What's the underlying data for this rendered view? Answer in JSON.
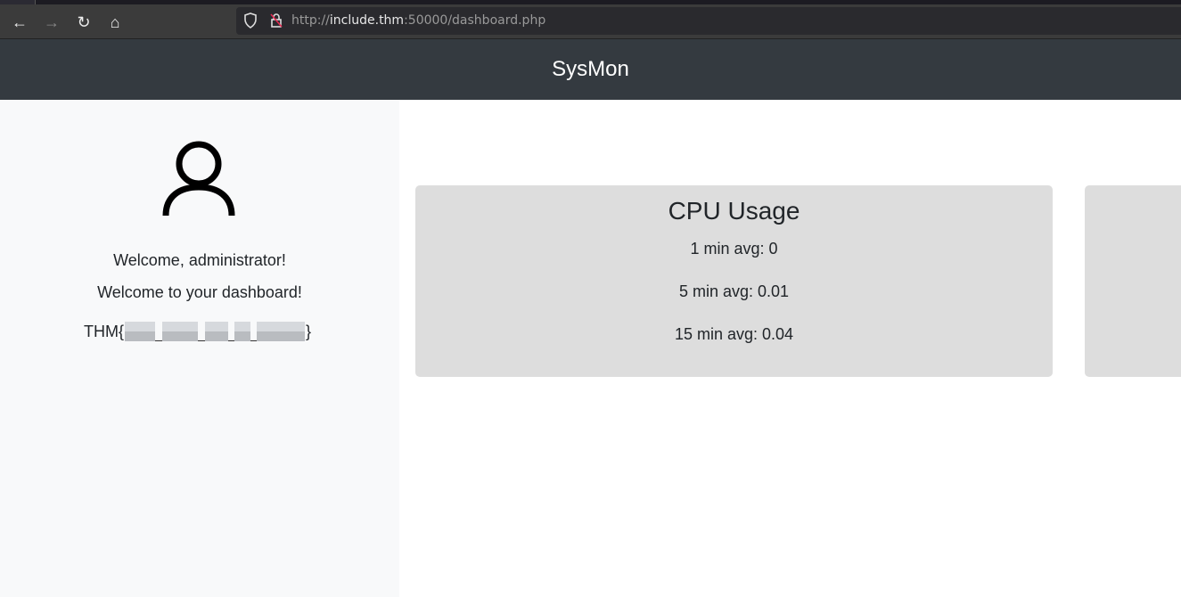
{
  "browser": {
    "url_scheme": "http://",
    "url_host": "include.thm",
    "url_rest": ":50000/dashboard.php",
    "icons": [
      "back-arrow-icon",
      "forward-arrow-icon",
      "reload-icon",
      "home-icon",
      "shield-icon",
      "insecure-lock-icon"
    ]
  },
  "header": {
    "title": "SysMon"
  },
  "sidebar": {
    "avatar_icon": "user-icon",
    "welcome_user": "Welcome, administrator!",
    "welcome_dashboard": "Welcome to your dashboard!",
    "flag_prefix": "THM{",
    "flag_suffix": "}"
  },
  "cards": [
    {
      "title": "CPU Usage",
      "lines": [
        "1 min avg: 0",
        "5 min avg: 0.01",
        "15 min avg: 0.04"
      ]
    }
  ]
}
